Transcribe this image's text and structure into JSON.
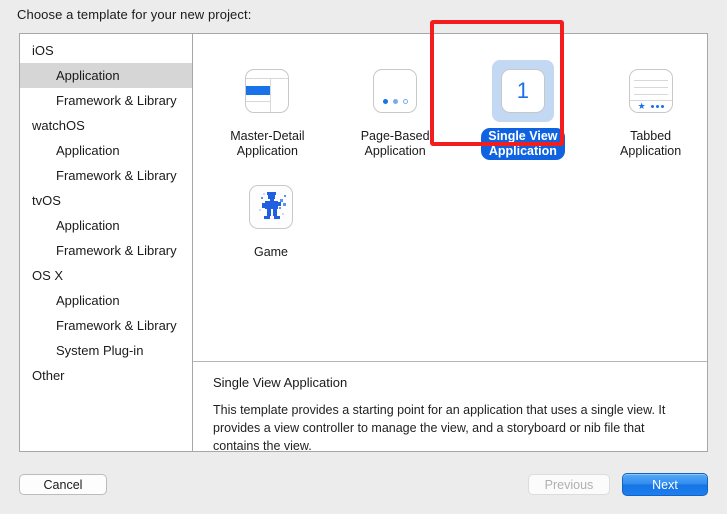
{
  "prompt": "Choose a template for your new project:",
  "sidebar": {
    "items": [
      {
        "label": "iOS",
        "level": "group",
        "selected": false
      },
      {
        "label": "Application",
        "level": "child",
        "selected": true
      },
      {
        "label": "Framework & Library",
        "level": "child",
        "selected": false
      },
      {
        "label": "watchOS",
        "level": "group",
        "selected": false
      },
      {
        "label": "Application",
        "level": "child",
        "selected": false
      },
      {
        "label": "Framework & Library",
        "level": "child",
        "selected": false
      },
      {
        "label": "tvOS",
        "level": "group",
        "selected": false
      },
      {
        "label": "Application",
        "level": "child",
        "selected": false
      },
      {
        "label": "Framework & Library",
        "level": "child",
        "selected": false
      },
      {
        "label": "OS X",
        "level": "group",
        "selected": false
      },
      {
        "label": "Application",
        "level": "child",
        "selected": false
      },
      {
        "label": "Framework & Library",
        "level": "child",
        "selected": false
      },
      {
        "label": "System Plug-in",
        "level": "child",
        "selected": false
      },
      {
        "label": "Other",
        "level": "group",
        "selected": false
      }
    ]
  },
  "templates": {
    "row1": [
      {
        "label": "Master-Detail\nApplication",
        "line1": "Master-Detail",
        "line2": "Application",
        "icon": "master-detail-icon",
        "selected": false
      },
      {
        "label": "Page-Based\nApplication",
        "line1": "Page-Based",
        "line2": "Application",
        "icon": "page-based-icon",
        "selected": false
      },
      {
        "label": "Single View\nApplication",
        "line1": "Single View",
        "line2": "Application",
        "icon": "single-view-icon",
        "selected": true,
        "badge": "1"
      },
      {
        "label": "Tabbed\nApplication",
        "line1": "Tabbed",
        "line2": "Application",
        "icon": "tabbed-icon",
        "selected": false
      }
    ],
    "row2": [
      {
        "label": "Game",
        "line1": "Game",
        "line2": "",
        "icon": "game-icon",
        "selected": false
      }
    ]
  },
  "description": {
    "title": "Single View Application",
    "body": "This template provides a starting point for an application that uses a single view. It provides a view controller to manage the view, and a storyboard or nib file that contains the view."
  },
  "footer": {
    "cancel": "Cancel",
    "previous": "Previous",
    "next": "Next"
  },
  "colors": {
    "accent_blue": "#1a72e8",
    "selection_pill": "#0f62e0",
    "icon_selection_bg": "#c3d8f3",
    "sidebar_selection": "#d6d6d6",
    "annotation_red": "#f41d1d",
    "window_bg": "#ececec"
  },
  "annotation": {
    "shape": "rectangle",
    "target": "Single View Application",
    "color": "#f41d1d"
  }
}
